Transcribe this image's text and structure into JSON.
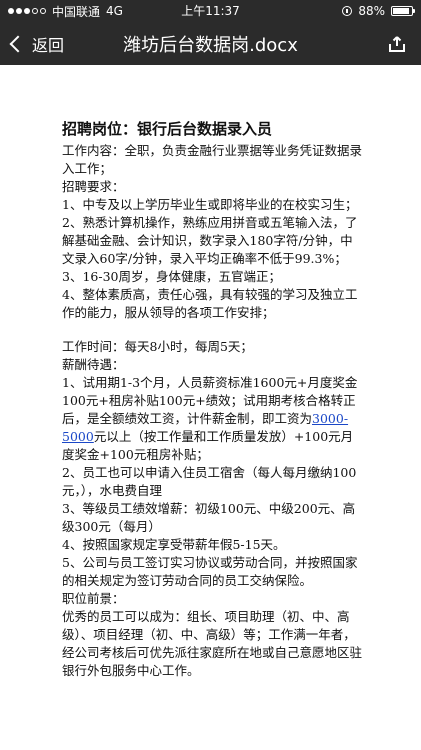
{
  "status": {
    "carrier": "中国联通",
    "network": "4G",
    "time": "上午11:37",
    "battery": "88%"
  },
  "nav": {
    "back_label": "返回",
    "title": "潍坊后台数据岗.docx"
  },
  "doc": {
    "heading": "招聘岗位：银行后台数据录入员",
    "p1": "工作内容：全职，负责金融行业票据等业务凭证数据录入工作；",
    "p2": "招聘要求：",
    "p3": "1、中专及以上学历毕业生或即将毕业的在校实习生；",
    "p4": "2、熟悉计算机操作，熟练应用拼音或五笔输入法，了解基础金融、会计知识，数字录入180字符/分钟，中文录入60字/分钟，录入平均正确率不低于99.3%；",
    "p5": "3、16-30周岁，身体健康，五官端正；",
    "p6": "4、整体素质高，责任心强，具有较强的学习及独立工作的能力，服从领导的各项工作安排；",
    "p7": "工作时间：每天8小时，每周5天；",
    "p8": "薪酬待遇：",
    "p9a": "1、试用期1-3个月，人员薪资标准1600元+月度奖金100元+租房补贴100元+绩效；试用期考核合格转正后，是全额绩效工资，计件薪金制，即工资为",
    "p9link": "3000-5000",
    "p9b": "元以上（按工作量和工作质量发放）+100元月度奖金+100元租房补贴；",
    "p10": "2、员工也可以申请入住员工宿舍（每人每月缴纳100元，），水电费自理",
    "p11": "3、等级员工绩效增薪：初级100元、中级200元、高级300元（每月）",
    "p12": "4、按照国家规定享受带薪年假5-15天。",
    "p13": "5、公司与员工签订实习协议或劳动合同，并按照国家的相关规定为签订劳动合同的员工交纳保险。",
    "p14": "职位前景：",
    "p15": "  优秀的员工可以成为：组长、项目助理（初、中、高级）、项目经理（初、中、高级）等；工作满一年者，经公司考核后可优先派往家庭所在地或自己意愿地区驻银行外包服务中心工作。"
  },
  "icons": {
    "back": "chevron-left-icon",
    "share": "share-icon",
    "lock": "orientation-lock-icon",
    "battery": "battery-icon"
  },
  "battery_level": 0.88
}
